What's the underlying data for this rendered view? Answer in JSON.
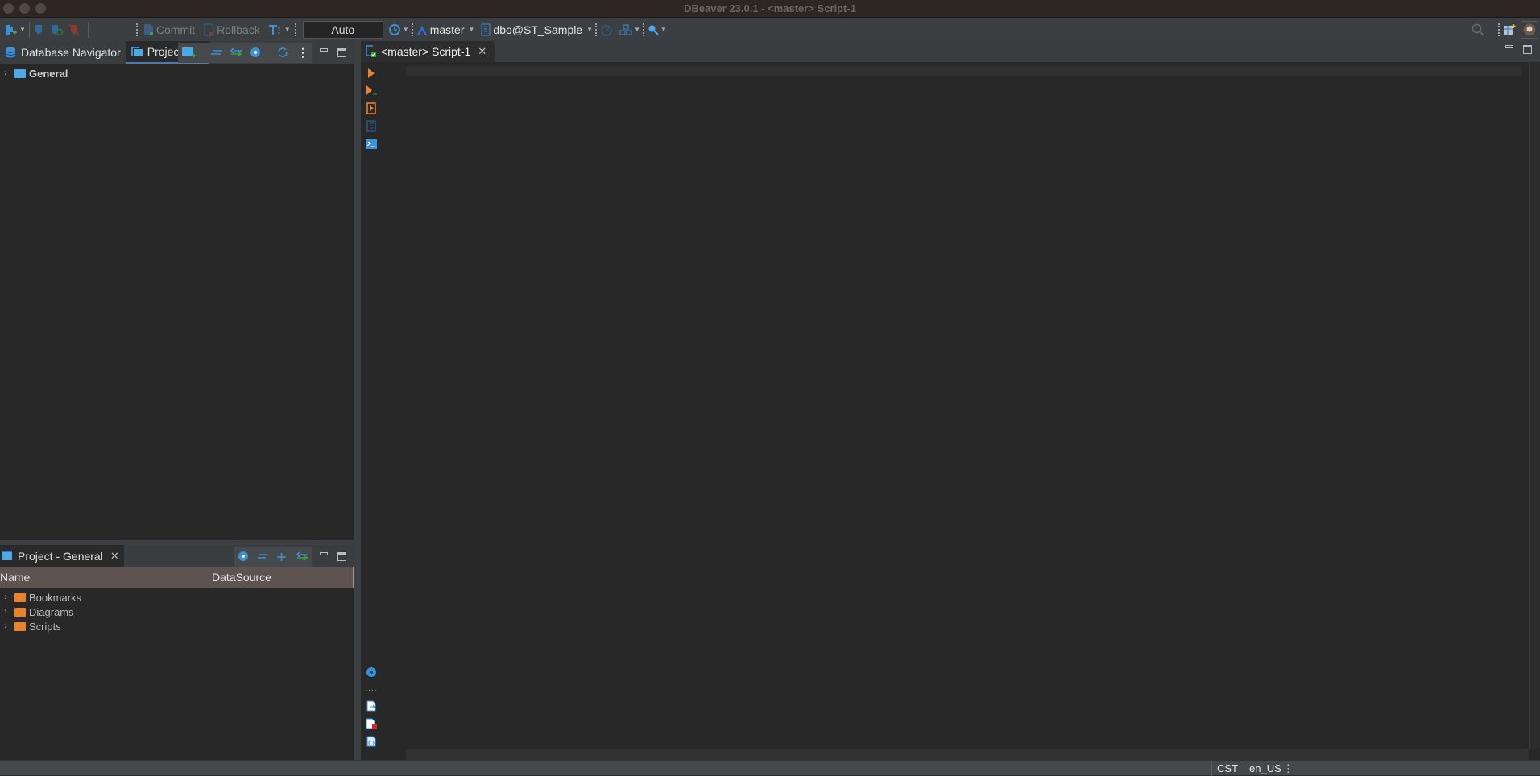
{
  "window": {
    "title": "DBeaver 23.0.1 - <master> Script-1"
  },
  "toolbar": {
    "commit_label": "Commit",
    "rollback_label": "Rollback",
    "transaction_mode": "Auto",
    "datasource": "master",
    "schema": "dbo@ST_Sample",
    "icons": [
      "new-connection-icon",
      "connect-icon",
      "reconnect-icon",
      "disconnect-icon",
      "commit-icon",
      "rollback-icon",
      "transaction-mode-icon",
      "history-icon",
      "datasource-icon",
      "schema-icon",
      "dashboard-icon",
      "plan-icon",
      "search-icon",
      "global-search-icon",
      "perspective-icon",
      "avatar"
    ]
  },
  "left_panel": {
    "tabs": [
      {
        "label": "Database Navigator",
        "active": false
      },
      {
        "label": "Projects",
        "active": true
      }
    ],
    "tree": [
      {
        "label": "General",
        "expanded": false,
        "bold": true
      }
    ]
  },
  "bottom_panel": {
    "tab_label": "Project - General",
    "columns": [
      "Name",
      "DataSource"
    ],
    "rows": [
      {
        "name": "Bookmarks",
        "datasource": ""
      },
      {
        "name": "Diagrams",
        "datasource": ""
      },
      {
        "name": "Scripts",
        "datasource": ""
      }
    ]
  },
  "editor": {
    "tab_label": "<master> Script-1",
    "content": ""
  },
  "statusbar": {
    "timezone": "CST",
    "locale": "en_US"
  },
  "colors": {
    "accent_blue": "#3d8fd6",
    "accent_orange": "#e8832a",
    "accent_green": "#3aa048"
  }
}
